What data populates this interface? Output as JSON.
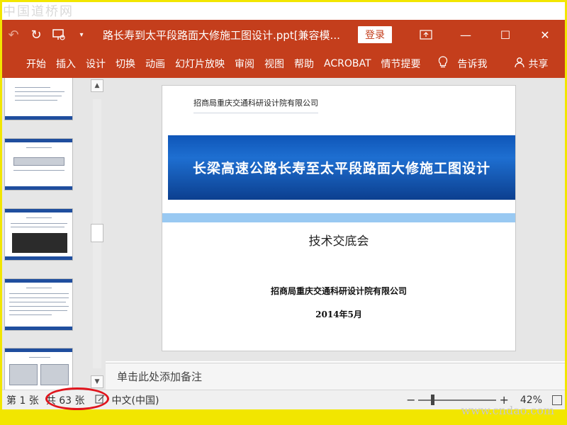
{
  "watermark": {
    "top": "中国道桥网",
    "bottom": "www.cndao.com"
  },
  "titlebar": {
    "undo_icon": "undo-icon",
    "redo_icon": "redo-icon",
    "present_icon": "present-from-start-icon",
    "customize_icon": "customize-qat-icon",
    "title": "路长寿到太平段路面大修施工图设计.ppt[兼容模...",
    "login_label": "登录",
    "ribbon_display_icon": "ribbon-display-icon",
    "minimize_icon": "minimize-icon",
    "maximize_icon": "maximize-icon",
    "close_icon": "close-icon"
  },
  "ribbon": {
    "tabs": [
      "开始",
      "插入",
      "设计",
      "切换",
      "动画",
      "幻灯片放映",
      "审阅",
      "视图",
      "帮助",
      "ACROBAT",
      "情节提要"
    ],
    "tell_label": "告诉我",
    "share_label": "共享"
  },
  "slide": {
    "org_top": "招商局重庆交通科研设计院有限公司",
    "banner_title": "长梁高速公路长寿至太平段路面大修施工图设计",
    "subtitle": "技术交底会",
    "org_bottom": "招商局重庆交通科研设计院有限公司",
    "date": "2014年5月"
  },
  "notes": {
    "placeholder": "单击此处添加备注"
  },
  "status": {
    "slide_info": "第 1 张",
    "total": "共 63 张",
    "language": "中文(中国)",
    "zoom_level": 42,
    "zoom_label": "42%"
  },
  "colors": {
    "accent": "#c43e1c",
    "banner": "#0f56b8",
    "stripe": "#99c9f2",
    "highlight_circle": "#e0151d",
    "frame": "#f2e600"
  }
}
